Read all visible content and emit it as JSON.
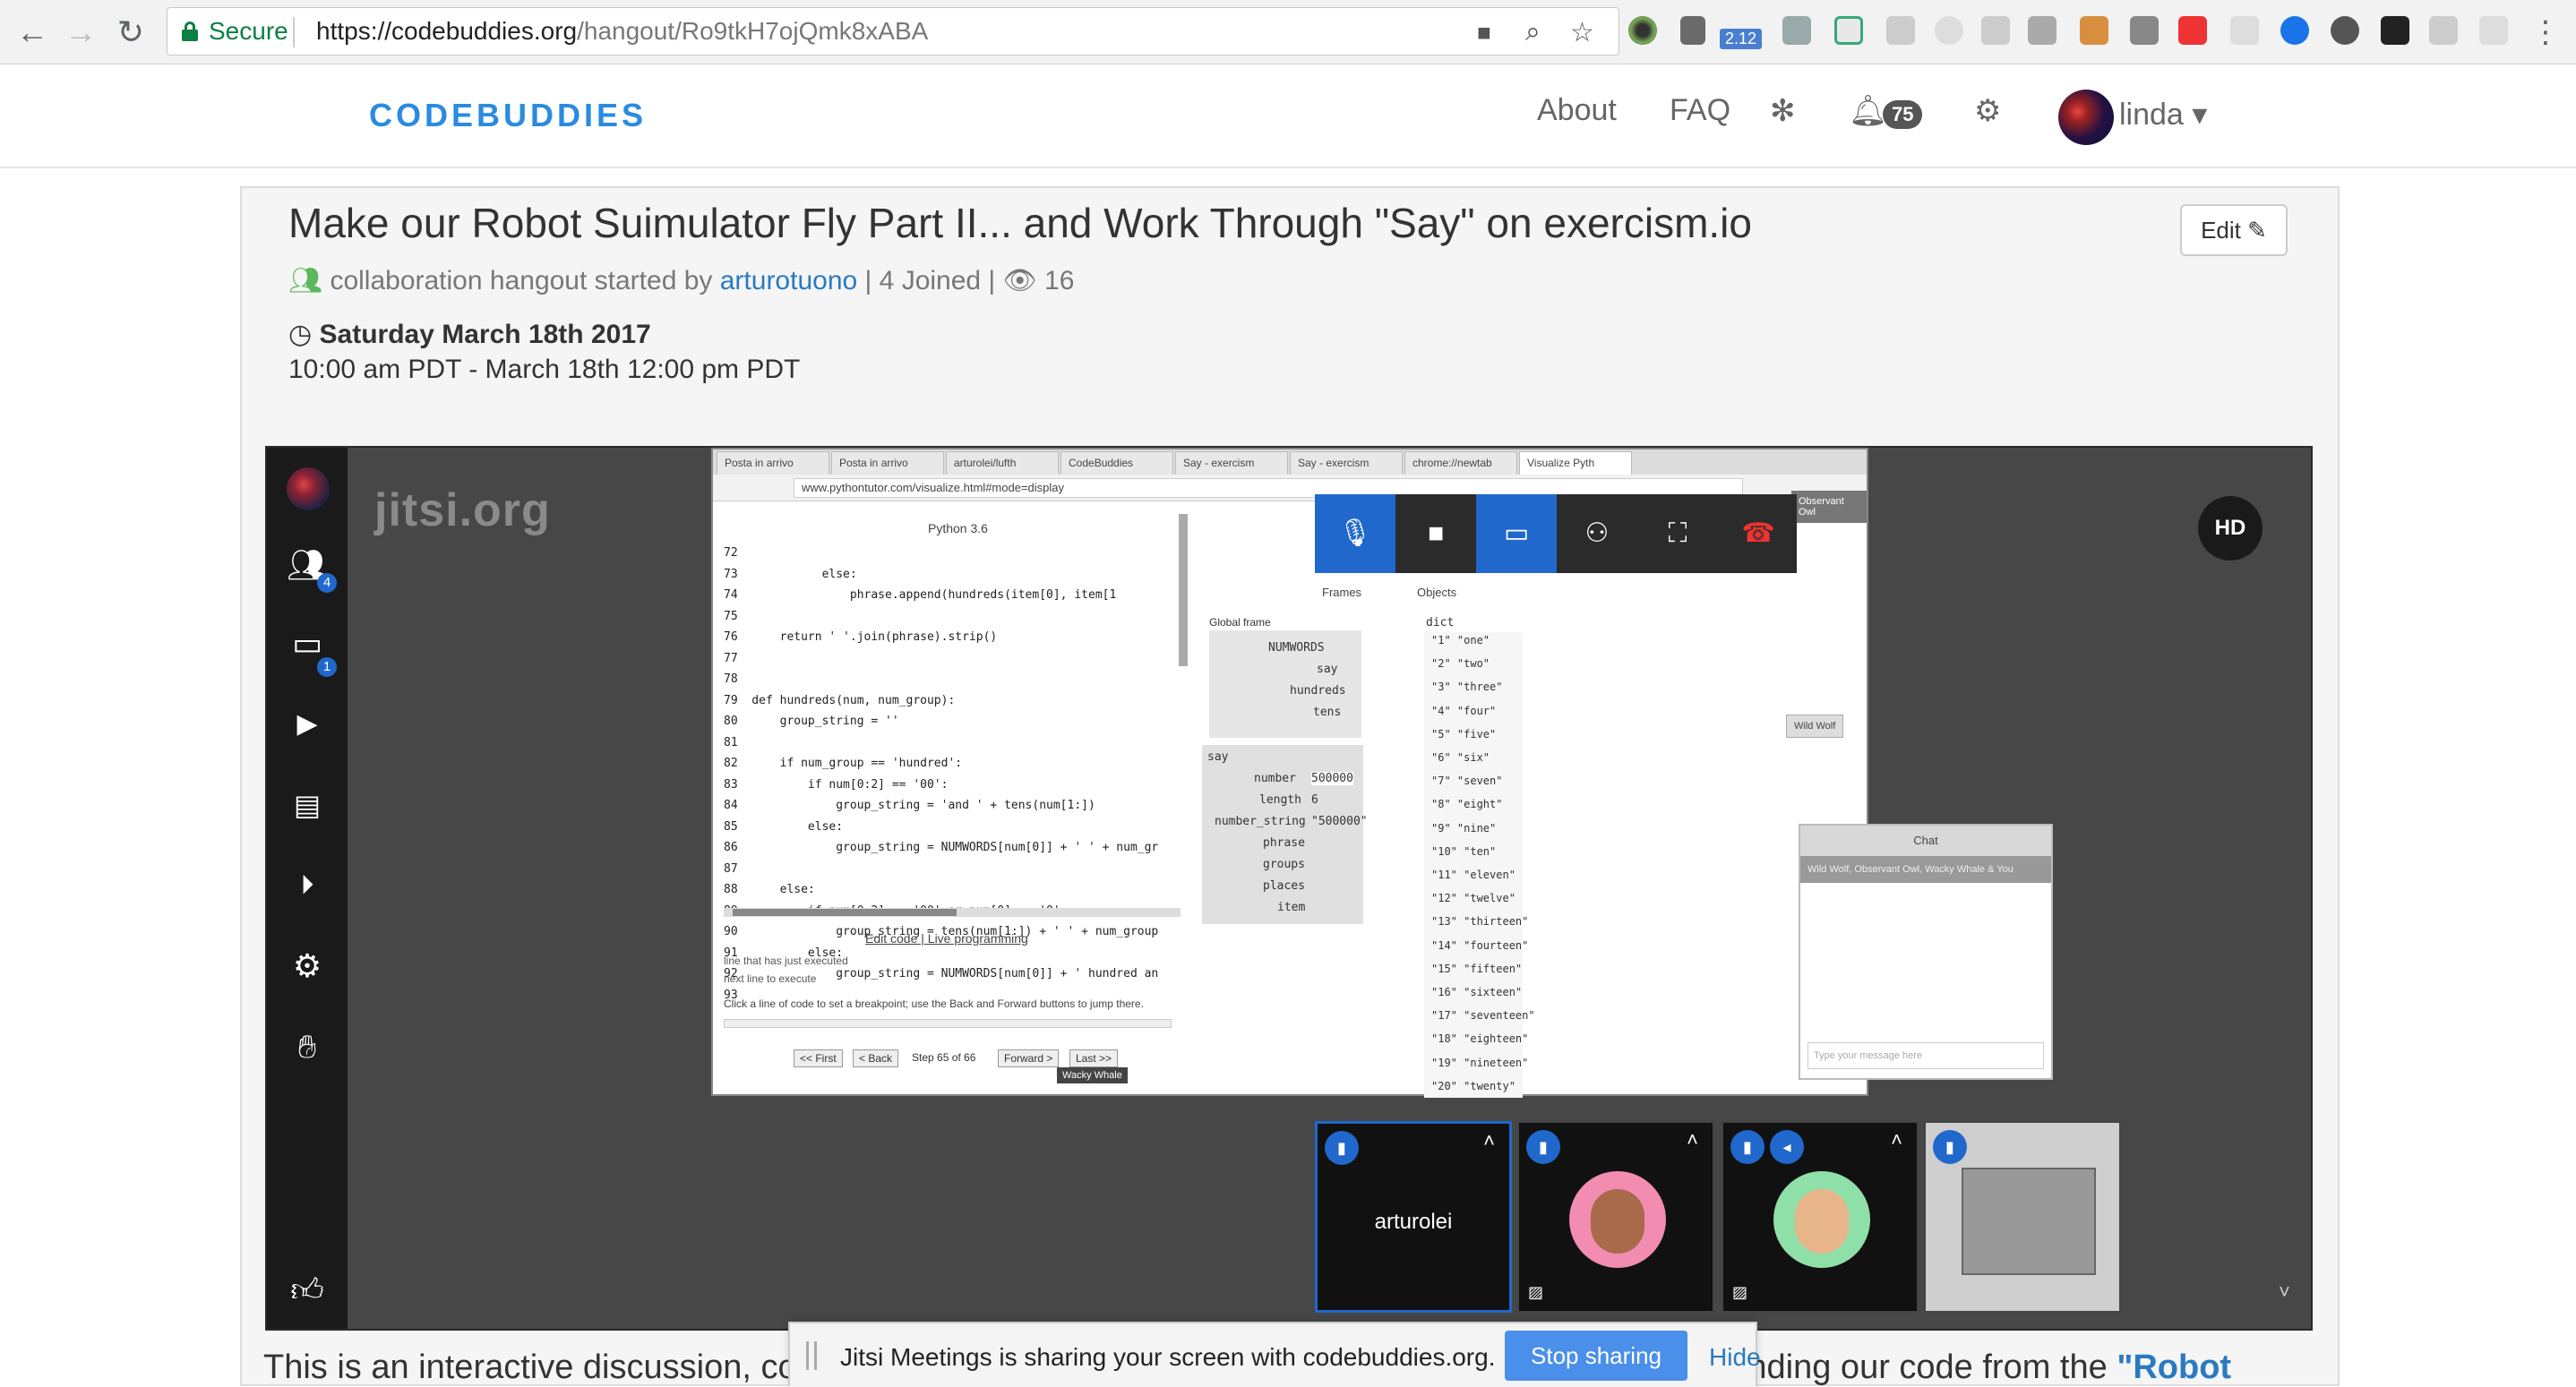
{
  "browser": {
    "secure_label": "Secure",
    "url_host": "https://codebuddies.org",
    "url_path": "/hangout/Ro9tkH7ojQmk8xABA",
    "ext_badge": "2.12"
  },
  "site": {
    "logo": "CODEBUDDIES",
    "nav_about": "About",
    "nav_faq": "FAQ",
    "notif_count": "75",
    "username": "linda ▾"
  },
  "hangout": {
    "title": "Make our Robot Suimulator Fly Part II... and Work Through \"Say\" on exercism.io",
    "edit_label": "Edit ✎",
    "meta_prefix": "collaboration hangout started by",
    "author": "arturotuono",
    "joined": "| 4 Joined |",
    "views": "16",
    "date": "Saturday March 18th 2017",
    "time": "10:00 am PDT - March 18th 12:00 pm PDT"
  },
  "jitsi": {
    "logo": "jitsi.org",
    "hd": "HD",
    "participants_badge": "4",
    "chat_badge": "1",
    "shared": {
      "tabs": [
        "Posta in arrivo",
        "Posta in arrivo",
        "arturolei/lufth",
        "CodeBuddies",
        "Say - exercism",
        "Say - exercism",
        "chrome://newtab",
        "Visualize Pyth"
      ],
      "address": "www.pythontutor.com/visualize.html#mode=display",
      "python_version": "Python 3.6",
      "code": "72\n73            else:\n74                phrase.append(hundreds(item[0], item[1\n75\n76      return ' '.join(phrase).strip()\n77\n78\n79  def hundreds(num, num_group):\n80      group_string = ''\n81\n82      if num_group == 'hundred':\n83          if num[0:2] == '00':\n84              group_string = 'and ' + tens(num[1:])\n85          else:\n86              group_string = NUMWORDS[num[0]] + ' ' + num_gr\n87\n88      else:\n89          if num[0:2] == '00' or num[0] == '0':\n90              group_string = tens(num[1:]) + ' ' + num_group\n91          else:\n92              group_string = NUMWORDS[num[0]] + ' hundred an\n93",
      "edit_code": "Edit code | Live programming",
      "legend1": "line that has just executed",
      "legend2": "next line to execute",
      "hint": "Click a line of code to set a breakpoint; use the Back and Forward buttons to jump there.",
      "step": "Step 65 of 66",
      "btn_first": "<< First",
      "btn_back": "< Back",
      "btn_forward": "Forward >",
      "btn_last": "Last >>",
      "frames": "Frames",
      "objects": "Objects",
      "global_frame": "Global frame",
      "globals": [
        "NUMWORDS",
        "say",
        "hundreds",
        "tens"
      ],
      "say_frame": "say",
      "say_vars": [
        "number",
        "length",
        "number_string",
        "phrase",
        "groups",
        "places",
        "item"
      ],
      "say_vals": [
        "500000",
        "6",
        "\"500000\"",
        "",
        "",
        "",
        ""
      ],
      "dict_label": "dict",
      "dict": [
        "\"1\"  \"one\"",
        "\"2\"  \"two\"",
        "\"3\"  \"three\"",
        "\"4\"  \"four\"",
        "\"5\"  \"five\"",
        "\"6\"  \"six\"",
        "\"7\"  \"seven\"",
        "\"8\"  \"eight\"",
        "\"9\"  \"nine\"",
        "\"10\"  \"ten\"",
        "\"11\"  \"eleven\"",
        "\"12\"  \"twelve\"",
        "\"13\"  \"thirteen\"",
        "\"14\"  \"fourteen\"",
        "\"15\"  \"fifteen\"",
        "\"16\"  \"sixteen\"",
        "\"17\"  \"seventeen\"",
        "\"18\"  \"eighteen\"",
        "\"19\"  \"nineteen\"",
        "\"20\"  \"twenty\""
      ],
      "chat_title": "Chat",
      "chat_members": "Wild Wolf, Observant Owl, Wacky Whale & You",
      "chat_placeholder": "Type your message here",
      "tip_owl": "Observant Owl",
      "tip_wolf": "Wild Wolf",
      "tip_whale": "Wacky Whale"
    },
    "thumb_name": "arturolei"
  },
  "notification": {
    "text": "Jitsi Meetings is sharing your screen with codebuddies.org.",
    "stop": "Stop sharing",
    "hide": "Hide"
  },
  "description": {
    "text": "This is an interactive discussion, coding, and learning session. We will be screen sharing, and extending our code from the ",
    "link": "\"Robot"
  }
}
